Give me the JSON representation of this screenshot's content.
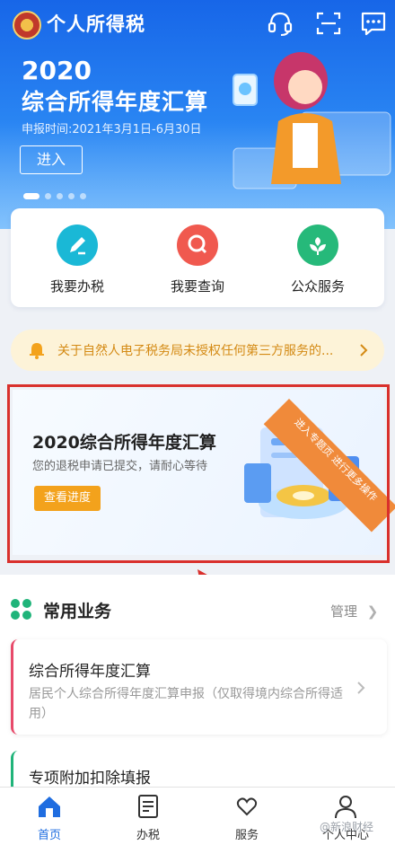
{
  "header": {
    "app_title": "个人所得税",
    "icons": [
      "headset-icon",
      "scan-icon",
      "message-icon"
    ]
  },
  "banner": {
    "year": "2020",
    "headline": "综合所得年度汇算",
    "period": "申报时间:2021年3月1日-6月30日",
    "enter_label": "进入",
    "active_slide": 1,
    "slide_count": 5
  },
  "quick_services": [
    {
      "label": "我要办税",
      "icon": "edit-icon",
      "color": "#1ab8d6"
    },
    {
      "label": "我要查询",
      "icon": "search-icon",
      "color": "#f0594f"
    },
    {
      "label": "公众服务",
      "icon": "flower-icon",
      "color": "#26b97a"
    }
  ],
  "notice": {
    "text": "关于自然人电子税务局未授权任何第三方服务的...",
    "icon": "bell-icon"
  },
  "settlement_card": {
    "title": "2020综合所得年度汇算",
    "subtitle": "您的退税申请已提交，请耐心等待",
    "button": "查看进度",
    "ribbon_text": "进入专题页 进行更多操作"
  },
  "common_business": {
    "title": "常用业务",
    "manage_label": "管理",
    "items": [
      {
        "title": "综合所得年度汇算",
        "desc": "居民个人综合所得年度汇算申报（仅取得境内综合所得适用）"
      },
      {
        "title": "专项附加扣除填报",
        "desc": ""
      }
    ]
  },
  "tabbar": [
    {
      "label": "首页",
      "icon": "home-icon",
      "active": true
    },
    {
      "label": "办税",
      "icon": "document-icon",
      "active": false
    },
    {
      "label": "服务",
      "icon": "heart-hands-icon",
      "active": false
    },
    {
      "label": "个人中心",
      "icon": "user-icon",
      "active": false
    }
  ],
  "watermark": "@新浪财经",
  "colors": {
    "brand_blue": "#1766e8",
    "alert_red": "#d9302c",
    "orange": "#f3a21c",
    "green": "#20b47a"
  }
}
